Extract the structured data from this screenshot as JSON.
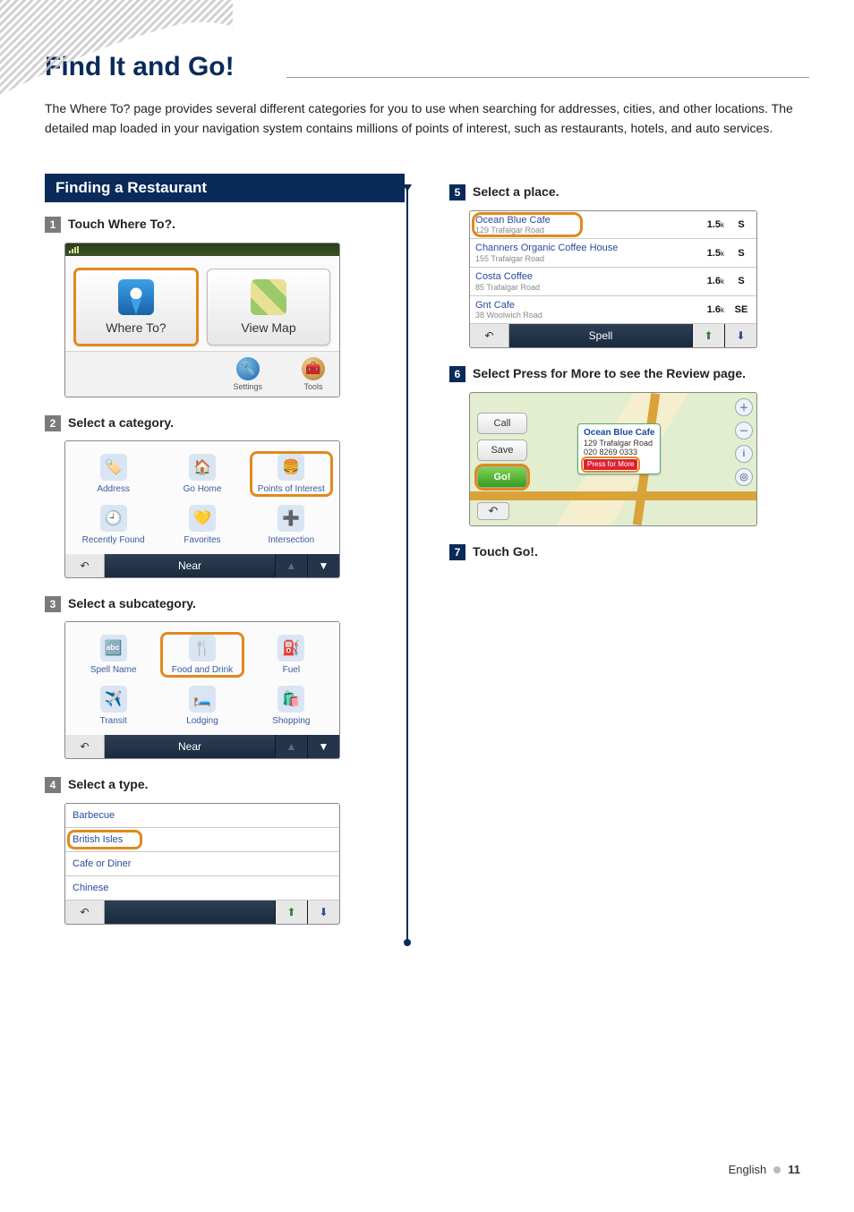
{
  "page": {
    "title": "Find It and Go!",
    "intro": "The Where To? page provides several different categories for you to use when searching for addresses, cities, and other locations. The detailed map loaded in your navigation system contains millions of points of interest, such as restaurants, hotels, and auto services.",
    "footer_lang": "English",
    "footer_page": "11"
  },
  "section": {
    "heading": "Finding a Restaurant"
  },
  "steps": {
    "s1": {
      "num": "1",
      "text": "Touch Where To?."
    },
    "s2": {
      "num": "2",
      "text": "Select a category."
    },
    "s3": {
      "num": "3",
      "text": "Select a subcategory."
    },
    "s4": {
      "num": "4",
      "text": "Select a type."
    },
    "s5": {
      "num": "5",
      "text": "Select a place."
    },
    "s6": {
      "num": "6",
      "text": " Select Press for More to see the Review page."
    },
    "s7": {
      "num": "7",
      "text": "Touch Go!."
    }
  },
  "shot1": {
    "where_to": "Where To?",
    "view_map": "View Map",
    "settings": "Settings",
    "tools": "Tools"
  },
  "shot2": {
    "cells": [
      "Address",
      "Go Home",
      "Points of Interest",
      "Recently Found",
      "Favorites",
      "Intersection"
    ],
    "bar_mid": "Near"
  },
  "shot3": {
    "cells": [
      "Spell Name",
      "Food and Drink",
      "Fuel",
      "Transit",
      "Lodging",
      "Shopping"
    ],
    "bar_mid": "Near"
  },
  "shot4": {
    "rows": [
      "Barbecue",
      "British Isles",
      "Cafe or Diner",
      "Chinese"
    ]
  },
  "shot5": {
    "rows": [
      {
        "name": "Ocean Blue Cafe",
        "sub": "129 Trafalgar Road",
        "dist": "1.5",
        "unit": "k",
        "dir": "S"
      },
      {
        "name": "Channers Organic Coffee House",
        "sub": "155 Trafalgar Road",
        "dist": "1.5",
        "unit": "k",
        "dir": "S"
      },
      {
        "name": "Costa Coffee",
        "sub": "85 Trafalgar Road",
        "dist": "1.6",
        "unit": "k",
        "dir": "S"
      },
      {
        "name": "Gnt Cafe",
        "sub": "38 Woolwich Road",
        "dist": "1.6",
        "unit": "k",
        "dir": "SE"
      }
    ],
    "bar_mid": "Spell"
  },
  "shot6": {
    "call": "Call",
    "save": "Save",
    "go": "Go!",
    "callout_title": "Ocean Blue Cafe",
    "callout_addr": "129 Trafalgar Road",
    "callout_phone": "020 8269 0333",
    "press_for_more": "Press for More"
  },
  "icons": {
    "back": "↶",
    "up": "▲",
    "down": "▼",
    "up2": "⬆",
    "down2": "⬇",
    "plus": "＋",
    "minus": "－",
    "info": "i",
    "target": "◎",
    "wrench": "🔧",
    "toolbox": "🧰"
  }
}
